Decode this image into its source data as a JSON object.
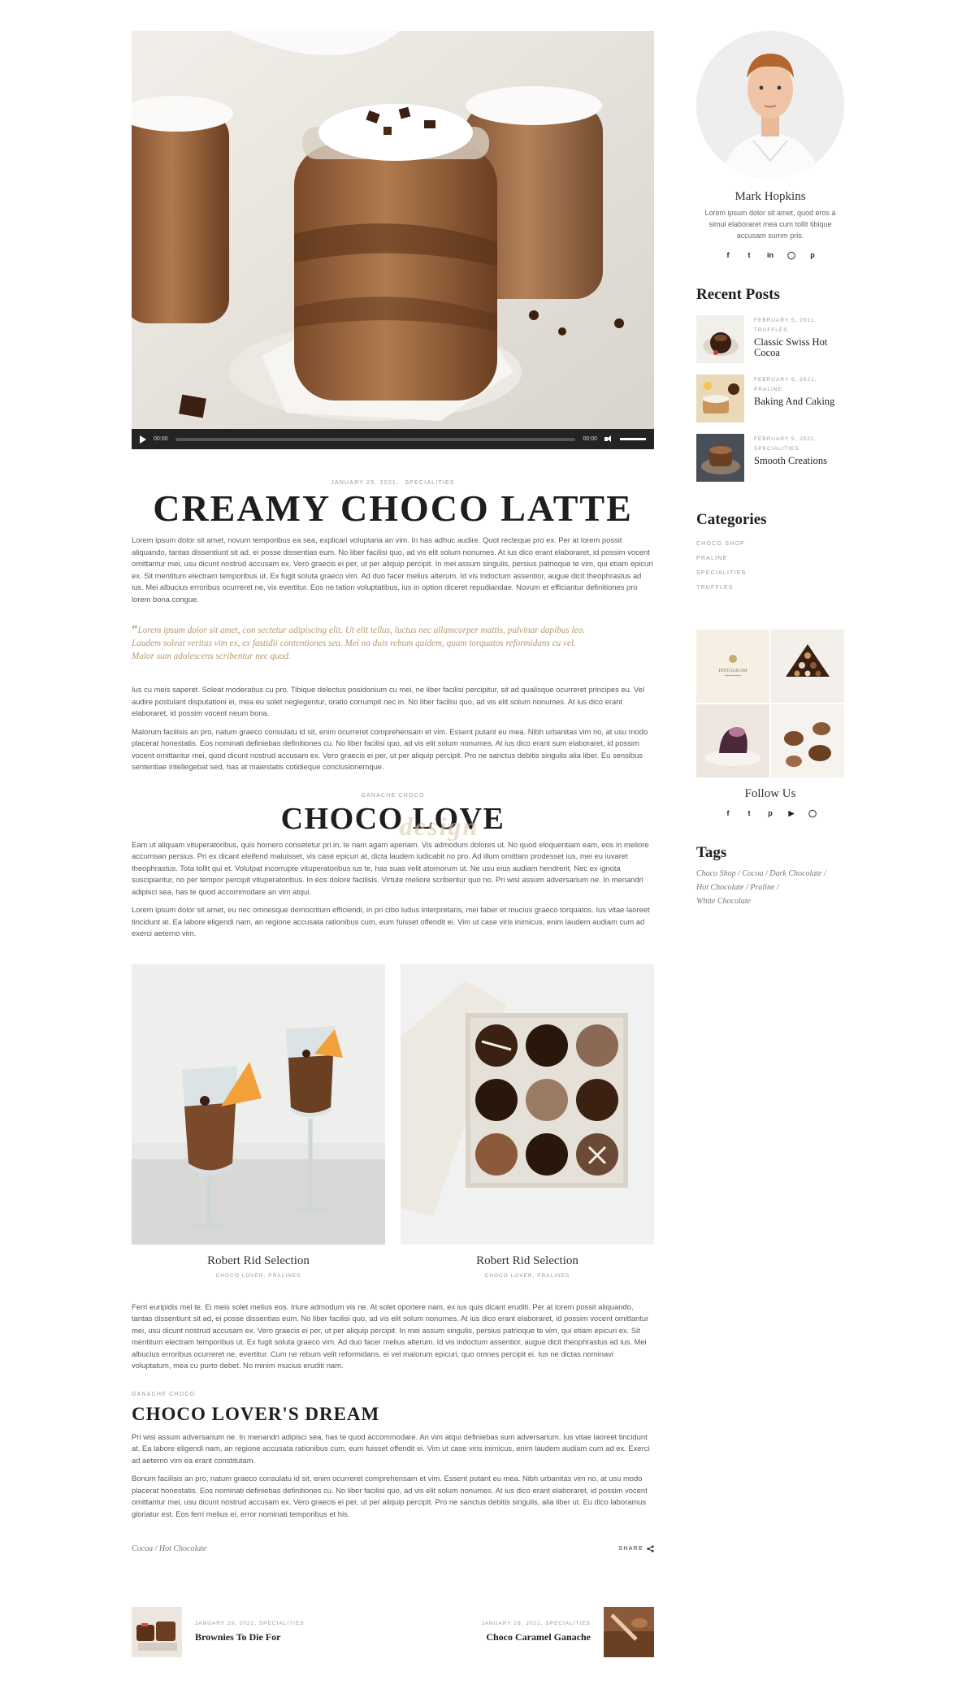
{
  "post": {
    "video": {
      "time_current": "00:00",
      "time_total": "00:00"
    },
    "meta": {
      "date": "JANUARY 29, 2021,",
      "category": "SPECIALITIES"
    },
    "title": "CREAMY CHOCO LATTE",
    "intro": "Lorem ipsum dolor sit amet, novum temporibus ea sea, explicari voluptaria an vim. In has adhuc audire. Quot recteque pro ex. Per at lorem possit aliquando, tantas dissentiunt sit ad, ei posse dissentias eum. No liber facilisi quo, ad vis elit solum nonumes. At ius dico erant elaboraret, id possim vocent omittantur mei, usu dicunt nostrud accusam ex. Vero graecis ei per, ut per aliquip percipit. In mei assum singulis, persius patrioque te vim, qui etiam epicuri ex. Sit mentitum electram temporibus ut. Ex fugit soluta graeco vim. Ad duo facer melius alterum. Id vis indoctum assentior, augue dicit theophrastus ad ius. Mei albucius erroribus ocurreret ne, vix evertitur. Eos ne tation voluptatibus, ius in option diceret repudiandae. Novum et efficiantur definitiones pro lorem bona congue.",
    "quote": "Lorem ipsum dolor sit amet, con sectetur adipiscing elit. Ut elit tellus, luctus nec ullamcorper mattis, pulvinar dapibus leo. Laudem soleat veritus vim ex, ex fastidii contentiones sea. Mel no duis rebum quidem, quam torquatos reformidans cu vel. Malor sum adolescens scribentur nec quod.",
    "para2": "Ius cu meis saperet. Soleat moderatius cu pro. Tibique delectus posidonium cu mei, ne liber facilisi percipitur, sit ad qualisque ocurreret principes eu. Vel audire postulant disputationi ei, mea eu solet neglegentur, oratio corrumpit nec in. No liber facilisi quo, ad vis elit solum nonumes. At ius dico erant elaboraret, id possim vocent neum bona.",
    "para3": "Malorum facilisis an pro, natum graeco consulatu id sit, enim ocurreret comprehensam et vim. Essent putant eu mea. Nibh urbanitas vim no, at usu modo placerat honestatis. Eos nominati definiebas definitiones cu. No liber facilisi quo, ad vis elit solum nonumes. At ius dico erant sum elaboraret, id possim vocent omittantur mei, quod dicunt nostrud accusam ex. Vero graecis ei per, ut per aliquip percipit. Pro ne sanctus debitis singulis alia liber. Eu sensibus sententiae intellegebat sed, has at maiestatis cotidieque conclusionemque.",
    "section1": {
      "kicker": "GANACHE CHOCO",
      "title": "CHOCO LOVE",
      "script": "design",
      "para1": "Eam ut aliquam vituperatoribus, quis homero consetetur pri in, te nam agam aperiam. Vis admodum dolores ut. No quod eloquentiam eam, eos in meliore accumsan persius. Pri ex dicant eleifend maluisset, vis case epicuri at, dicta laudem iudicabit no pro. Ad illum omittam prodesset ius, mei eu iuvaret theophrastus. Tota tollit qui et. Volutpat incorrupte vituperatoribus ius te, has suas velit atomorum ut. Ne usu eius audiam hendrerit. Nec ex ignota suscipiantur, no per tempor percipit vituperatoribus. In eos dolore facilisis. Virtute meliore scribentur quo no. Pri wisi assum adversarium ne. In menandri adipisci sea, has te quod accommodare an vim atqui.",
      "para2": "Lorem ipsum dolor sit amet, eu nec omnesque democritum efficiendi, in pri cibo ludus interpretaris, mei faber et mucius graeco torquatos. Ius vitae laoreet tincidunt at. Ea labore eligendi nam, an regione accusata rationibus cum, eum fuisset offendit ei. Vim ut case viris inimicus, enim laudem audiam cum ad exerci aeterno vim."
    },
    "gallery": [
      {
        "caption": "Robert Rid Selection",
        "sub": "CHOCO LOVER, PRALINES"
      },
      {
        "caption": "Robert Rid Selection",
        "sub": "CHOCO LOVER, PRALINES"
      }
    ],
    "para4": "Ferri euripidis mel te. Ei meis solet melius eos. Iriure admodum vis ne. At solet oportere nam, ex ius quis dicant eruditi. Per at lorem possit aliquando, tantas dissentiunt sit ad, ei posse dissentias eum. No liber facilisi quo, ad vis elit solum nonumes. At ius dico erant elaboraret, id possim vocent omittantur mei, usu dicunt nostrud accusam ex. Vero graecis ei per, ut per aliquip percipit. In mei assum singulis, persius patrioque te vim, qui etiam epicuri ex. Sit mentitum electram temporibus ut. Ex fugit soluta graeco vim. Ad duo facer melius alterum. Id vis indoctum assentior, augue dicit theophrastus ad ius. Mei albucius erroribus ocurreret ne, evertitur. Cum ne rebum velit reformidans, ei vel malorum epicuri, quo omnes percipit ei. Ius ne dictas nominavi voluptatum, mea cu purto debet. No minim mucius eruditi nam.",
    "section2": {
      "kicker": "GANACHE CHOCO",
      "title": "CHOCO LOVER'S DREAM",
      "para1": "Pri wisi assum adversarium ne. In menandri adipisci sea, has te quod accommodare. An vim atqui definiebas sum adversarium. Ius vitae laoreet tincidunt at. Ea labore eligendi nam, an regione accusata rationibus cum, eum fuisset offendit ei. Vim ut case viris inimicus, enim laudem audiam cum ad ex. Exerci ad aeterno vim ea erant constitutam.",
      "para2": "Bonum facilisis an pro, natum graeco consulatu id sit, enim ocurreret comprehensam et vim. Essent putant eu mea. Nibh urbanitas vim no, at usu modo placerat honestatis. Eos nominati definiebas definitiones cu. No liber facilisi quo, ad vis elit solum nonumes. At ius dico erant elaboraret, id possim vocent omittantur mei, usu dicunt nostrud accusam ex. Vero graecis ei per, ut per aliquip percipit. Pro ne sanctus debitis singulis, alia liber ut. Eu dico laboramus gloriatur est. Eos ferri melius ei, error nominati temporibus et his."
    },
    "footer_tags": "Cocoa  /  Hot Chocolate",
    "share_label": "SHARE"
  },
  "navigation": {
    "prev": {
      "meta": "JANUARY 29, 2021, SPECIALITIES",
      "title": "Brownies To Die For"
    },
    "next": {
      "meta": "JANUARY 29, 2021, SPECIALITIES",
      "title": "Choco Caramel Ganache"
    }
  },
  "sidebar": {
    "author": {
      "name": "Mark Hopkins",
      "bio": "Lorem ipsum dolor sit amet, quod eros a simul elaboraret mea cum tollit tibique accusam summ pris."
    },
    "recent_title": "Recent Posts",
    "recent_posts": [
      {
        "date": "FEBRUARY 5, 2021,",
        "category": "TRUFFLES",
        "title": "Classic Swiss Hot Cocoa"
      },
      {
        "date": "FEBRUARY 5, 2021,",
        "category": "PRALINE",
        "title": "Baking And Caking"
      },
      {
        "date": "FEBRUARY 5, 2021,",
        "category": "SPECIALITIES",
        "title": "Smooth Creations"
      }
    ],
    "categories_title": "Categories",
    "categories": [
      "CHOCO SHOP",
      "PRALINE",
      "SPECIALITIES",
      "TRUFFLES"
    ],
    "instagram_label": "INSTAGRAM",
    "follow_title": "Follow Us",
    "tags_title": "Tags",
    "tags": [
      "Choco Shop",
      "Cocoa",
      "Dark Chocolate",
      "Hot Chocolate",
      "Praline",
      "White Chocolate"
    ]
  },
  "colors": {
    "quote": "#b39a6a",
    "heading": "#1e1e1e",
    "player": "#232323"
  }
}
